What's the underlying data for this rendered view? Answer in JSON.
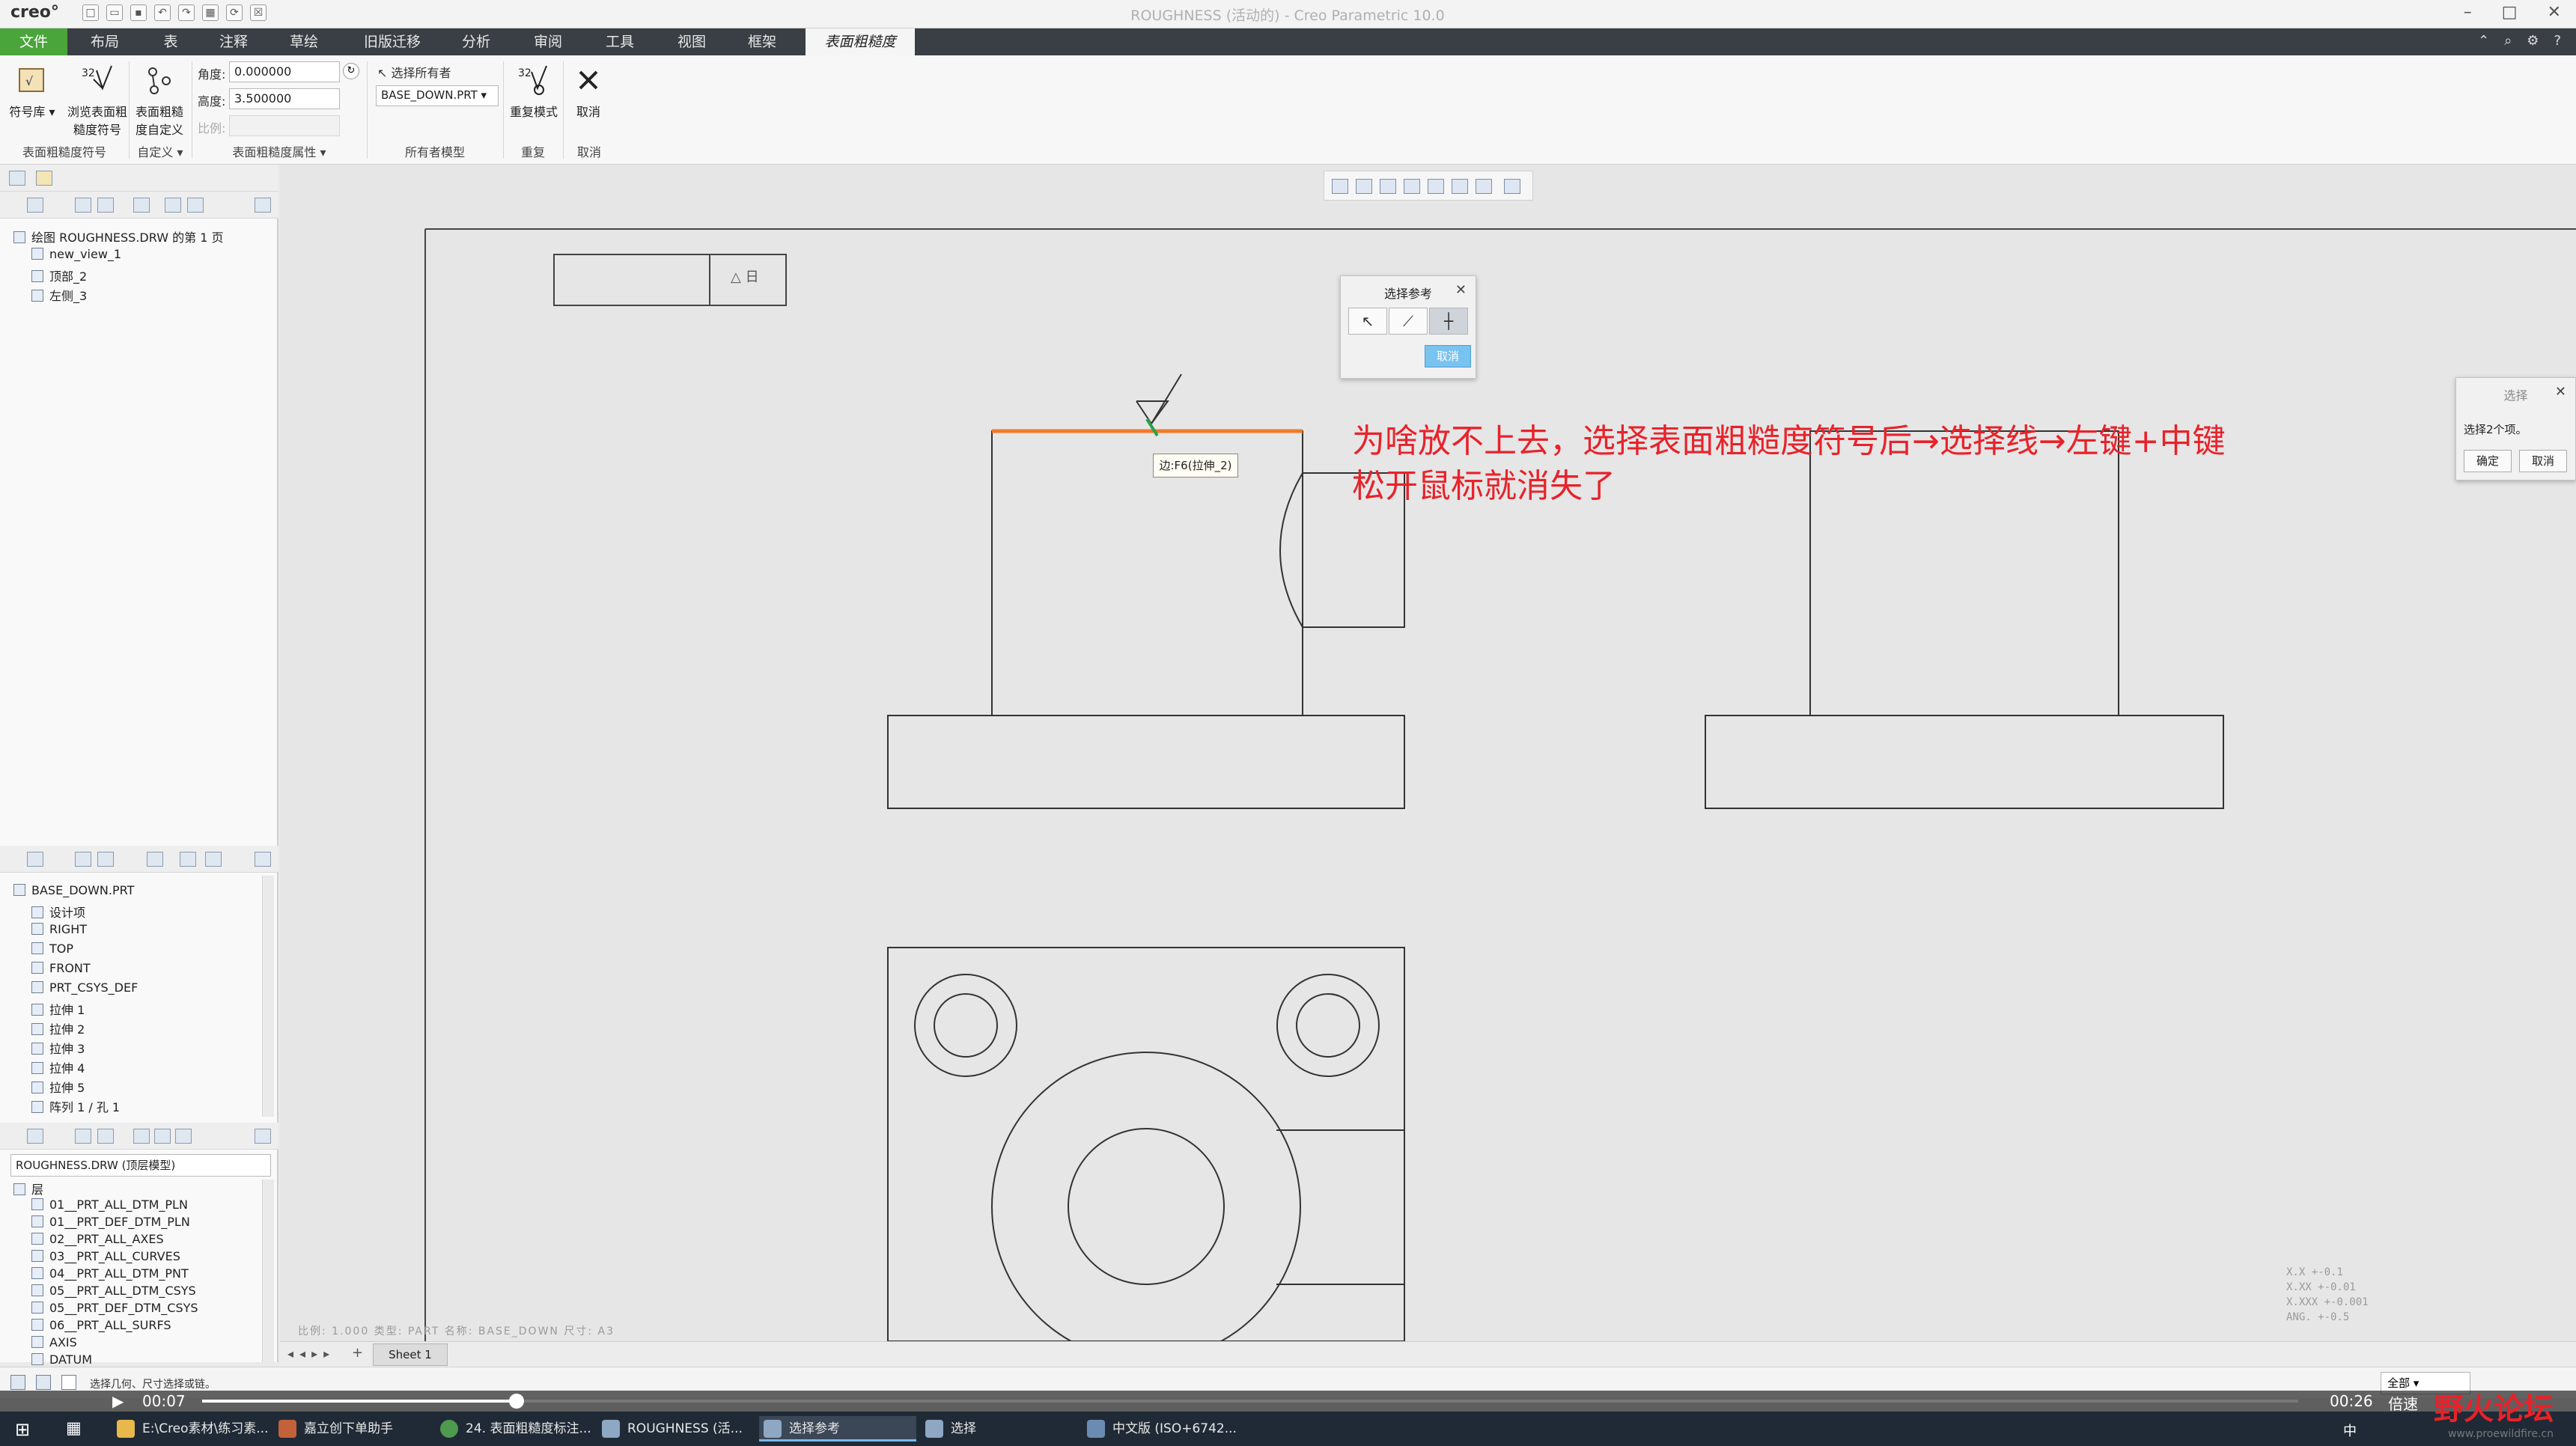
{
  "app": {
    "logo": "creo°",
    "window_title": "ROUGHNESS (活动的) - Creo Parametric 10.0"
  },
  "tabs": [
    "文件",
    "布局",
    "表",
    "注释",
    "草绘",
    "旧版迁移",
    "分析",
    "审阅",
    "工具",
    "视图",
    "框架",
    "表面粗糙度"
  ],
  "ribbon": {
    "symbol_library": "符号库",
    "browse_symbols_line1": "浏览表面粗",
    "browse_symbols_line2": "糙度符号",
    "custom_line1": "表面粗糙",
    "custom_line2": "度自定义",
    "angle_label": "角度:",
    "angle_value": "0.000000",
    "height_label": "高度:",
    "height_value": "3.500000",
    "scale_label": "比例:",
    "select_owner": "选择所有者",
    "owner_model": "BASE_DOWN.PRT",
    "repeat_mode": "重复模式",
    "cancel": "取消",
    "groups": {
      "symbol": "表面粗糙度符号",
      "custom": "自定义",
      "properties": "表面粗糙度属性",
      "owner": "所有者模型",
      "repeat": "重复",
      "cancel": "取消"
    }
  },
  "drawing_tree": {
    "root": "绘图 ROUGHNESS.DRW 的第 1 页",
    "items": [
      "new_view_1",
      "顶部_2",
      "左侧_3"
    ]
  },
  "model_tree": {
    "root": "BASE_DOWN.PRT",
    "items": [
      "设计项",
      "RIGHT",
      "TOP",
      "FRONT",
      "PRT_CSYS_DEF",
      "拉伸 1",
      "拉伸 2",
      "拉伸 3",
      "拉伸 4",
      "拉伸 5",
      "阵列 1 / 孔 1"
    ]
  },
  "layer_tree": {
    "model": "ROUGHNESS.DRW (顶层模型)",
    "root": "层",
    "items": [
      "01__PRT_ALL_DTM_PLN",
      "01__PRT_DEF_DTM_PLN",
      "02__PRT_ALL_AXES",
      "03__PRT_ALL_CURVES",
      "04__PRT_ALL_DTM_PNT",
      "05__PRT_ALL_DTM_CSYS",
      "05__PRT_DEF_DTM_CSYS",
      "06__PRT_ALL_SURFS",
      "AXIS",
      "DATUM"
    ]
  },
  "dialog_ref": {
    "title": "选择参考",
    "cancel": "取消"
  },
  "dialog_select": {
    "title": "选择",
    "message": "选择2个项。",
    "ok": "确定",
    "cancel": "取消"
  },
  "canvas": {
    "tooltip": "边:F6(拉伸_2)",
    "annotation_line1": "为啥放不上去，选择表面粗糙度符号后→选择线→左键+中键",
    "annotation_line2": "松开鼠标就消失了",
    "title_block": "比例: 1.000   类型: PART   名称: BASE_DOWN   尺寸: A3",
    "tolerance": [
      "X.X    +-0.1",
      "X.XX   +-0.01",
      "X.XXX  +-0.001",
      "ANG.   +-0.5"
    ],
    "title_block_top": "△ 日"
  },
  "sheet_tab": "Sheet 1",
  "status": "选择几何、尺寸选择或链。",
  "filter_value": "全部",
  "video": {
    "current": "00:07",
    "duration": "00:26",
    "speed": "倍速",
    "progress": 0.15
  },
  "taskbar": {
    "items": [
      "E:\\Creo素材\\练习素...",
      "嘉立创下单助手",
      "24. 表面粗糙度标注...",
      "ROUGHNESS (活...",
      "选择参考",
      "选择",
      "中文版 (ISO+6742..."
    ]
  },
  "watermark": {
    "name": "野火论坛",
    "url": "www.proewildfire.cn"
  }
}
